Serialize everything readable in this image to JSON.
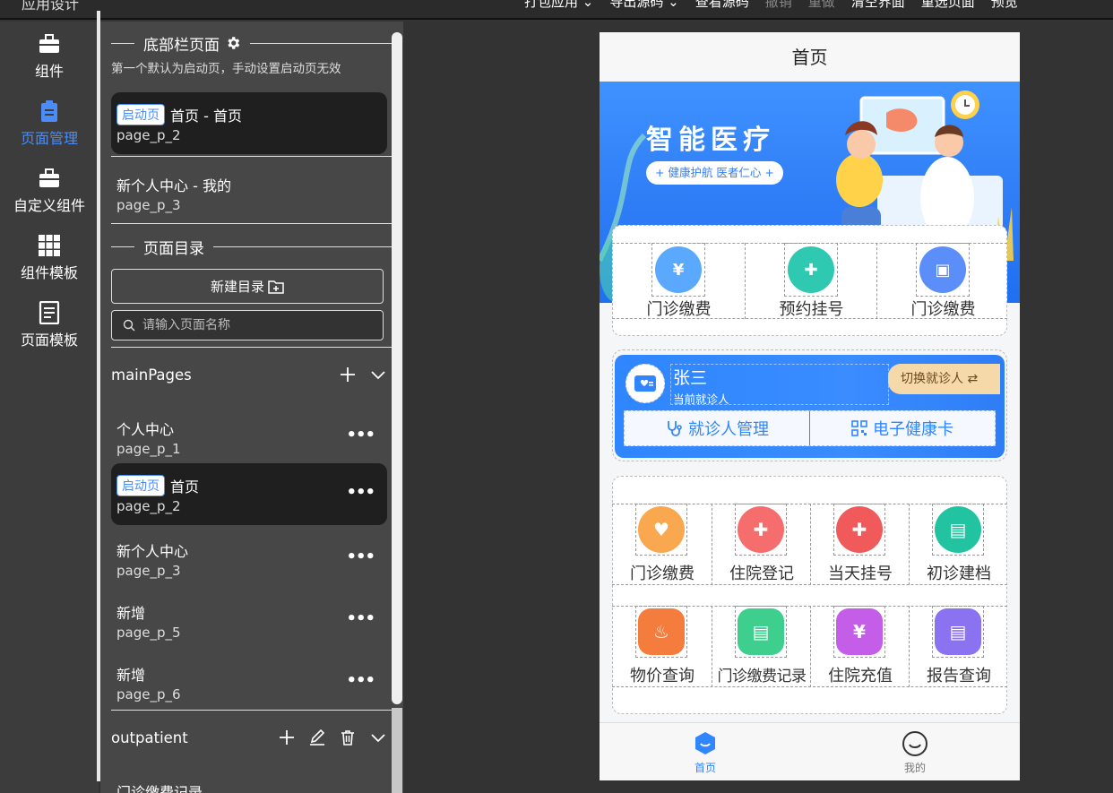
{
  "app": {
    "title": "应用设计"
  },
  "topmenu": [
    {
      "label": "打包应用 ⌄",
      "disabled": false
    },
    {
      "label": "导出源码 ⌄",
      "disabled": false
    },
    {
      "label": "查看源码",
      "disabled": false
    },
    {
      "label": "撤销",
      "disabled": true
    },
    {
      "label": "重做",
      "disabled": true
    },
    {
      "label": "清空界面",
      "disabled": false
    },
    {
      "label": "重选页面",
      "disabled": false
    },
    {
      "label": "预览",
      "disabled": false
    }
  ],
  "rail": [
    {
      "label": "组件",
      "icon": "briefcase-icon",
      "active": false
    },
    {
      "label": "页面管理",
      "icon": "clipboard-icon",
      "active": true
    },
    {
      "label": "自定义组件",
      "icon": "briefcase-icon",
      "active": false
    },
    {
      "label": "组件模板",
      "icon": "grid-icon",
      "active": false
    },
    {
      "label": "页面模板",
      "icon": "document-icon",
      "active": false
    }
  ],
  "tabbar_section": {
    "title": "底部栏页面",
    "hint": "第一个默认为启动页，手动设置启动页无效",
    "pages": [
      {
        "badge": "启动页",
        "title": "首页 - 首页",
        "id": "page_p_2",
        "selected": true
      },
      {
        "badge": "",
        "title": "新个人中心 - 我的",
        "id": "page_p_3",
        "selected": false
      }
    ]
  },
  "directory_section": {
    "title": "页面目录",
    "new_button": "新建目录",
    "search_placeholder": "请输入页面名称"
  },
  "groups": [
    {
      "name": "mainPages",
      "pages": [
        {
          "badge": "",
          "title": "个人中心",
          "id": "page_p_1",
          "selected": false
        },
        {
          "badge": "启动页",
          "title": "首页",
          "id": "page_p_2",
          "selected": true
        },
        {
          "badge": "",
          "title": "新个人中心",
          "id": "page_p_3",
          "selected": false
        },
        {
          "badge": "",
          "title": "新增",
          "id": "page_p_5",
          "selected": false
        },
        {
          "badge": "",
          "title": "新增",
          "id": "page_p_6",
          "selected": false
        }
      ]
    },
    {
      "name": "outpatient",
      "pages": [
        {
          "badge": "",
          "title": "门诊缴费记录",
          "id": "",
          "selected": false
        }
      ]
    }
  ],
  "more_glyph": "•••",
  "phone": {
    "header_title": "首页",
    "banner": {
      "title": "智能医疗",
      "slogan": "+ 健康护航 医者仁心 +"
    },
    "quick": [
      {
        "label": "门诊缴费",
        "color": "#5aa9ff",
        "glyph": "¥"
      },
      {
        "label": "预约挂号",
        "color": "#2ec9b0",
        "glyph": "✚"
      },
      {
        "label": "门诊缴费",
        "color": "#5b8ef8",
        "glyph": "▣"
      }
    ],
    "patient": {
      "name": "张三",
      "subtitle": "当前就诊人",
      "switch_label": "切换就诊人 ⇄",
      "manage_label": "就诊人管理",
      "card_label": "电子健康卡"
    },
    "services": [
      {
        "label": "门诊缴费",
        "color": "#f9a84f",
        "glyph": "♥"
      },
      {
        "label": "住院登记",
        "color": "#f56d6d",
        "glyph": "✚"
      },
      {
        "label": "当天挂号",
        "color": "#f05a5a",
        "glyph": "✚"
      },
      {
        "label": "初诊建档",
        "color": "#22c3a0",
        "glyph": "▤"
      },
      {
        "label": "物价查询",
        "color": "#f47c3c",
        "glyph": "♨"
      },
      {
        "label": "门诊缴费记录",
        "color": "#3ecf8e",
        "glyph": "▤"
      },
      {
        "label": "住院充值",
        "color": "#c45ee8",
        "glyph": "¥"
      },
      {
        "label": "报告查询",
        "color": "#8a72f0",
        "glyph": "▤"
      }
    ],
    "tabs": [
      {
        "label": "首页",
        "active": true
      },
      {
        "label": "我的",
        "active": false
      }
    ]
  },
  "colors": {
    "accent": "#4a8df8",
    "panel": "#474747",
    "rail": "#3c3c3c",
    "canvas": "#333333"
  }
}
